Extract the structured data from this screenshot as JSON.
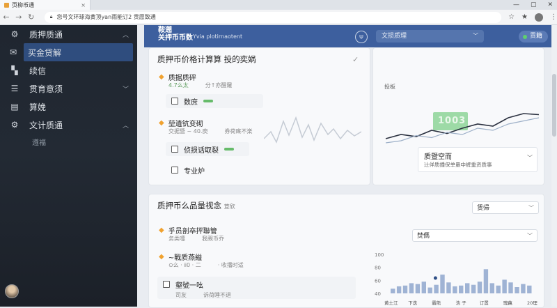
{
  "browser": {
    "tab_title": "页柳币通",
    "url": "您号文环球海黄顶yan雨能订2 贡愿致通"
  },
  "sidebar": {
    "items": [
      {
        "label": "质押质通",
        "icon": "gear-icon"
      },
      {
        "label": "买金贷解",
        "icon": "mail-icon"
      },
      {
        "label": "续信",
        "icon": "grid-icon"
      },
      {
        "label": "贯育意须",
        "icon": "list-icon"
      },
      {
        "label": "算娩",
        "icon": "file-icon"
      },
      {
        "label": "文计质通",
        "icon": "gear-icon"
      }
    ],
    "sub_item": "遵福"
  },
  "header": {
    "title_line1": "鞍遡",
    "title_line2": "关押币币数",
    "subtitle": "Yvia plotirnaotent",
    "select_value": "文损质理",
    "button_label": "贡籍"
  },
  "card1": {
    "title": "质押币价格计算算 投的奕娲",
    "row1_title": "质据质砰",
    "row1_sub": [
      "4.7么太",
      "分↑亦醒羅"
    ],
    "check1": "数庶",
    "row2_title": "堃遺钪变砌",
    "row2_sub": [
      "交据暨 ~ 40.庾",
      "券荷廐不楽"
    ],
    "check2": "侦损话取裂",
    "check3": "专业炉"
  },
  "right_panel": {
    "label": "投板",
    "highlight": "1003",
    "info_title": "质暨空而",
    "info_sub": "辻佯质播保单量中裤重资质事"
  },
  "card2": {
    "title": "质押币么品量视念",
    "title_suffix": "荳欣",
    "select_top": "赁帰",
    "row1_title": "乎员剖卒抨聯管",
    "row1_sub": [
      "务类嚏",
      "我觋币乔"
    ],
    "select_right": "焚傌",
    "row2_title": "~戰质燕縊",
    "row2_sub": [
      "⊙么 · ⅱ0 · 二",
      "· 收播时适"
    ],
    "check1": "壑號一吆",
    "check1_sub": [
      "司友",
      "诉荷睡不退"
    ]
  },
  "bars_chart": {
    "y_ticks": [
      "100",
      "80",
      "60",
      "40"
    ],
    "x_ticks": [
      "黄土江",
      "下迭",
      "霸熊",
      "浩 子",
      "订置",
      "瑰藕",
      "20理"
    ]
  },
  "chart_data": [
    {
      "type": "line",
      "series": [
        {
          "values": [
            30,
            34,
            32,
            38,
            35,
            40,
            44,
            42,
            50,
            54,
            53
          ]
        },
        {
          "values": [
            26,
            28,
            33,
            31,
            36,
            34,
            40,
            38,
            44,
            47,
            50
          ]
        }
      ]
    },
    {
      "type": "bar",
      "x": [
        "黄土江",
        "下迭",
        "霸熊",
        "浩 子",
        "订置",
        "瑰藕",
        "20理"
      ],
      "values": [
        12,
        18,
        20,
        26,
        24,
        30,
        15,
        22,
        48,
        28,
        18,
        20,
        26,
        22,
        30,
        62,
        26,
        20,
        35,
        28,
        16,
        24,
        20
      ],
      "ylim": [
        0,
        100
      ]
    }
  ]
}
